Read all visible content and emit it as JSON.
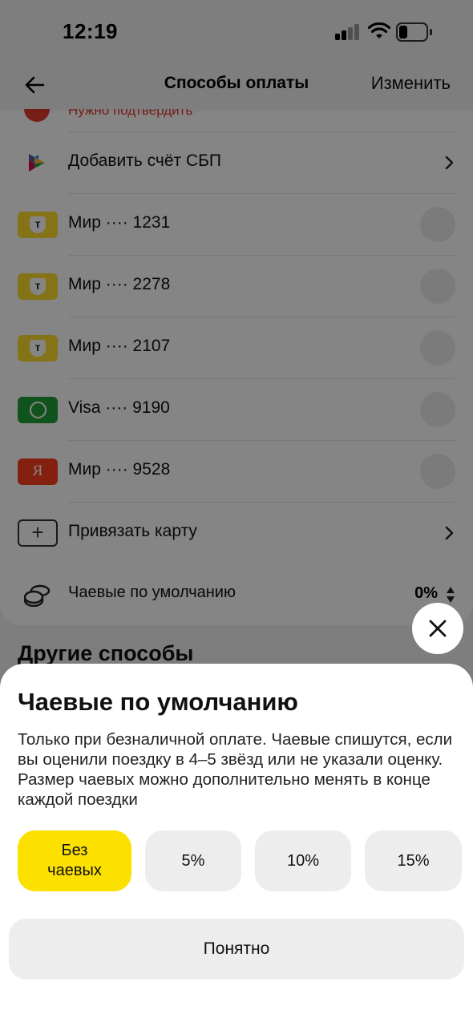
{
  "status": {
    "time": "12:19"
  },
  "header": {
    "title": "Способы оплаты",
    "edit_label": "Изменить"
  },
  "confirm_text": "Нужно подтвердить",
  "rows": {
    "sbp": {
      "label": "Добавить счёт СБП"
    },
    "cards": [
      {
        "label": "Мир ···· 1231",
        "icon": "t-bank-card-icon",
        "color": "#ffdd2d"
      },
      {
        "label": "Мир ···· 2278",
        "icon": "t-bank-card-icon",
        "color": "#ffdd2d"
      },
      {
        "label": "Мир ···· 2107",
        "icon": "t-bank-card-icon",
        "color": "#ffdd2d"
      },
      {
        "label": "Visa ···· 9190",
        "icon": "sber-card-icon",
        "color": "#21a038"
      },
      {
        "label": "Мир ···· 9528",
        "icon": "yandex-card-icon",
        "color": "#fc3f1d"
      }
    ],
    "add_card": {
      "label": "Привязать карту"
    },
    "tips": {
      "label": "Чаевые по умолчанию",
      "value": "0%"
    }
  },
  "other_title": "Другие способы",
  "sheet": {
    "title": "Чаевые по умолчанию",
    "description": "Только при безналичной оплате. Чаевые спишутся, если вы оценили поездку в 4–5 звёзд или не указали оценку. Размер чаевых можно дополнительно менять в конце каждой поездки",
    "options": [
      {
        "line1": "Без",
        "line2": "чаевых",
        "selected": true
      },
      {
        "line1": "5%",
        "selected": false
      },
      {
        "line1": "10%",
        "selected": false
      },
      {
        "line1": "15%",
        "selected": false
      }
    ],
    "ok_label": "Понятно"
  },
  "colors": {
    "accent": "#fce000",
    "warning": "#e23b2e"
  }
}
